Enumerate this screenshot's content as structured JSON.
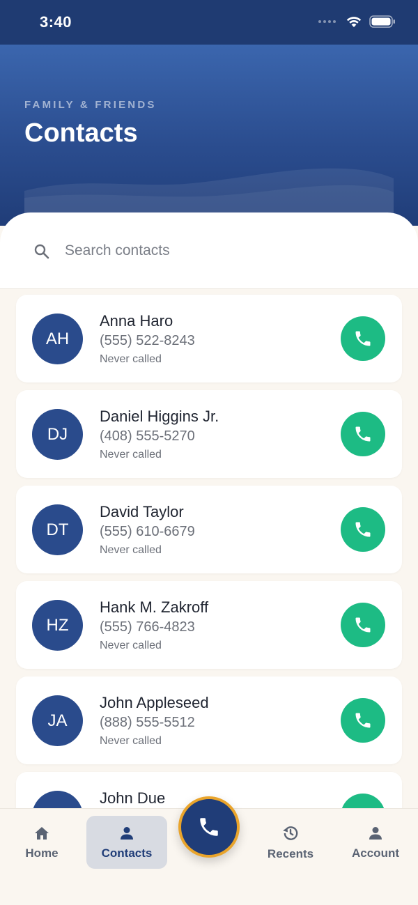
{
  "status_bar": {
    "time": "3:40"
  },
  "header": {
    "eyebrow": "FAMILY & FRIENDS",
    "title": "Contacts"
  },
  "search": {
    "placeholder": "Search contacts"
  },
  "contacts": [
    {
      "initials": "AH",
      "name": "Anna Haro",
      "phone": "(555) 522-8243",
      "status": "Never called"
    },
    {
      "initials": "DJ",
      "name": "Daniel Higgins Jr.",
      "phone": "(408) 555-5270",
      "status": "Never called"
    },
    {
      "initials": "DT",
      "name": "David Taylor",
      "phone": "(555) 610-6679",
      "status": "Never called"
    },
    {
      "initials": "HZ",
      "name": "Hank M. Zakroff",
      "phone": "(555) 766-4823",
      "status": "Never called"
    },
    {
      "initials": "JA",
      "name": "John Appleseed",
      "phone": "(888) 555-5512",
      "status": "Never called"
    },
    {
      "initials": "",
      "name": "John Due",
      "phone": "",
      "status": ""
    }
  ],
  "tabs": [
    {
      "label": "Home",
      "icon": "home-icon"
    },
    {
      "label": "Contacts",
      "icon": "person-icon",
      "active": true
    },
    {
      "label": "Recents",
      "icon": "history-icon"
    },
    {
      "label": "Account",
      "icon": "person-icon"
    }
  ],
  "fab": {
    "icon": "phone-icon"
  },
  "colors": {
    "primary": "#203d78",
    "call": "#1dbb84",
    "fab_ring": "#e9a42b",
    "background": "#faf6f0"
  }
}
